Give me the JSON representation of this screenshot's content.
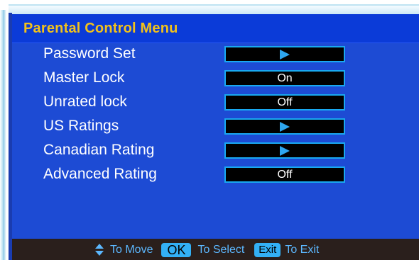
{
  "header": {
    "title": "Parental Control Menu"
  },
  "menu": {
    "items": [
      {
        "label": "Password Set",
        "value": "",
        "arrow": true
      },
      {
        "label": "Master Lock",
        "value": "On",
        "arrow": false
      },
      {
        "label": "Unrated lock",
        "value": "Off",
        "arrow": false
      },
      {
        "label": "US Ratings",
        "value": "",
        "arrow": true
      },
      {
        "label": "Canadian Rating",
        "value": "",
        "arrow": true
      },
      {
        "label": "Advanced Rating",
        "value": "Off",
        "arrow": false
      }
    ]
  },
  "footer": {
    "move_text": "To Move",
    "ok_key": "OK",
    "select_text": "To Select",
    "exit_key": "Exit",
    "exit_text": "To Exit"
  },
  "colors": {
    "background": "#1d4bd4",
    "title": "#f2c21b",
    "box_border": "#19a8f0",
    "footer_bg": "#2a1f1c",
    "footer_text": "#5cb8ff"
  }
}
